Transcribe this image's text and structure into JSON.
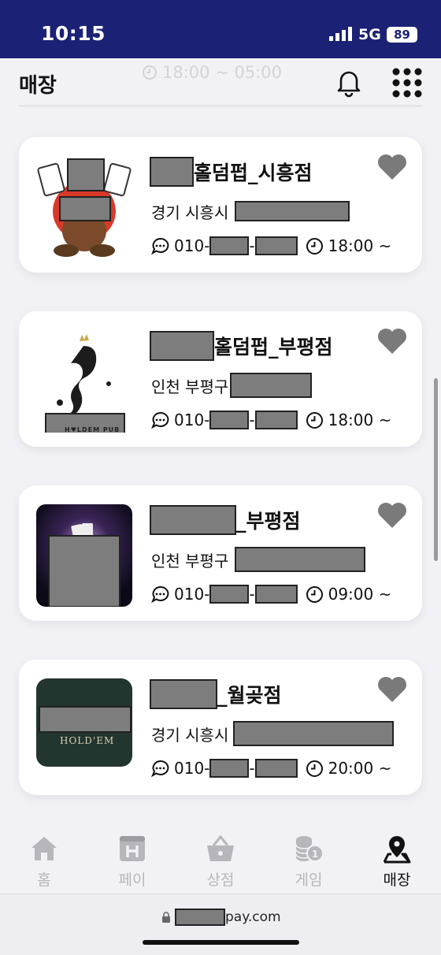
{
  "status_bar": {
    "time": "10:15",
    "network": "5G",
    "battery": "89"
  },
  "header": {
    "title": "매장",
    "ghost_hours": "18:00 ~ 05:00"
  },
  "stores": [
    {
      "name_suffix": "홀덤펍_시흥점",
      "region": "경기 시흥시",
      "phone_prefix": "010-",
      "hours": "18:00 ~"
    },
    {
      "name_suffix": "홀덤펍_부평점",
      "region": "인천 부평구",
      "phone_prefix": "010-",
      "hours": "18:00 ~",
      "logo_text": "H♥LDEM PUB"
    },
    {
      "name_suffix": "_부평점",
      "region": "인천 부평구",
      "phone_prefix": "010-",
      "hours": "09:00 ~"
    },
    {
      "name_suffix": "_월곶점",
      "region": "경기 시흥시",
      "phone_prefix": "010-",
      "hours": "20:00 ~",
      "logo_text": "HOLD'EM"
    }
  ],
  "tabs": [
    {
      "label": "홈",
      "icon": "home-icon"
    },
    {
      "label": "페이",
      "icon": "hotel-icon"
    },
    {
      "label": "상점",
      "icon": "basket-icon"
    },
    {
      "label": "게임",
      "icon": "coins-icon"
    },
    {
      "label": "매장",
      "icon": "map-pin-icon",
      "active": true
    }
  ],
  "url_bar": {
    "domain_suffix": "pay.com"
  },
  "colors": {
    "status_bar": "#1b2175",
    "heart": "#7a7a7a",
    "inactive_tab": "#b6b6bc"
  }
}
